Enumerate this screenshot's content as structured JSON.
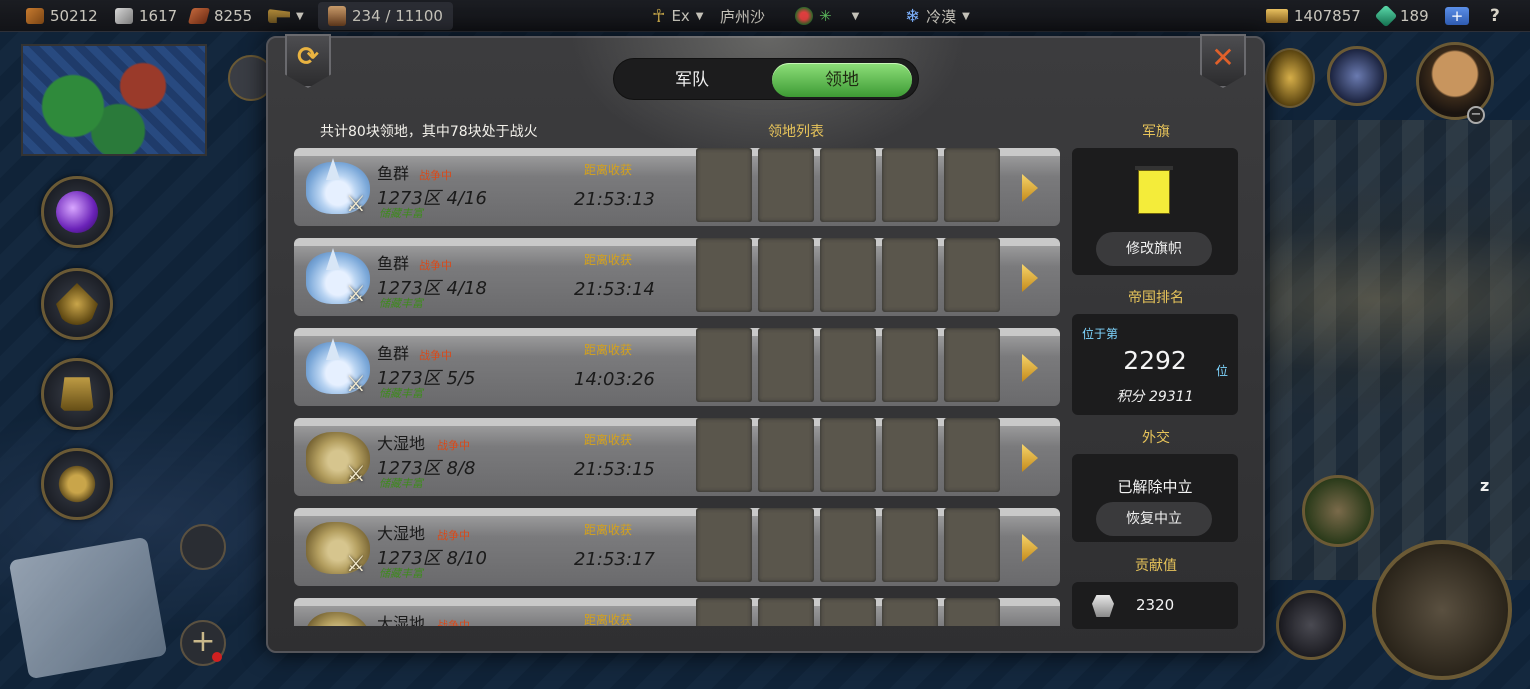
{
  "topbar": {
    "res1": "50212",
    "res2": "1617",
    "res3": "8255",
    "population": "234 / 11100",
    "faith": "Ex",
    "city": "庐州沙",
    "climate": "冷漠",
    "gold": "1407857",
    "gems": "189",
    "plus": "+",
    "help": "?"
  },
  "panel": {
    "tabs": {
      "army": "军队",
      "territory": "领地",
      "active": "territory"
    },
    "summary": "共计80块领地，其中78块处于战火",
    "list_title": "领地列表",
    "territories": [
      {
        "type": "fish",
        "name": "鱼群",
        "status": "战争中",
        "zone": "1273区 4/16",
        "reserve": "储藏丰富",
        "harvest_label": "距离收获",
        "timer": "21:53:13"
      },
      {
        "type": "fish",
        "name": "鱼群",
        "status": "战争中",
        "zone": "1273区 4/18",
        "reserve": "储藏丰富",
        "harvest_label": "距离收获",
        "timer": "21:53:14"
      },
      {
        "type": "fish",
        "name": "鱼群",
        "status": "战争中",
        "zone": "1273区 5/5",
        "reserve": "储藏丰富",
        "harvest_label": "距离收获",
        "timer": "14:03:26"
      },
      {
        "type": "swamp",
        "name": "大湿地",
        "status": "战争中",
        "zone": "1273区 8/8",
        "reserve": "储藏丰富",
        "harvest_label": "距离收获",
        "timer": "21:53:15"
      },
      {
        "type": "swamp",
        "name": "大湿地",
        "status": "战争中",
        "zone": "1273区 8/10",
        "reserve": "储藏丰富",
        "harvest_label": "距离收获",
        "timer": "21:53:17"
      },
      {
        "type": "swamp",
        "name": "大湿地",
        "status": "战争中",
        "zone": "",
        "reserve": "",
        "harvest_label": "距离收获",
        "timer": ""
      }
    ],
    "sidebar": {
      "banner_title": "军旗",
      "banner_button": "修改旗帜",
      "banner_color": "#f4ec3a",
      "rank_title": "帝国排名",
      "rank_prefix": "位于第",
      "rank_value": "2292",
      "rank_suffix": "位",
      "score": "积分  29311",
      "diplomacy_title": "外交",
      "diplomacy_status": "已解除中立",
      "diplomacy_button": "恢复中立",
      "contribution_title": "贡献值",
      "contribution_value": "2320"
    }
  },
  "map": {
    "z_label": "z"
  }
}
